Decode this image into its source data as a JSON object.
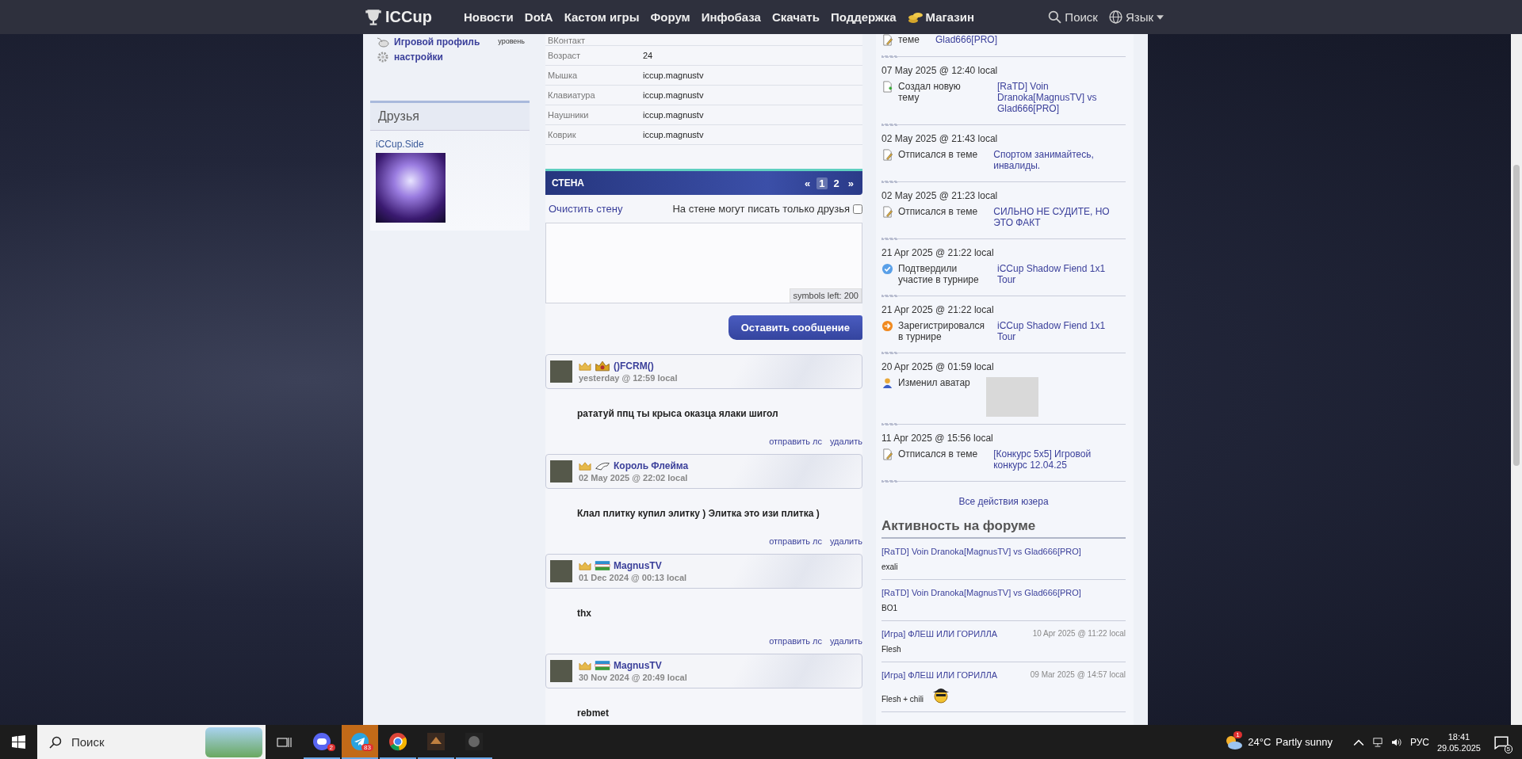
{
  "nav": {
    "logo": "ICCup",
    "items": [
      {
        "label": "Новости",
        "kind": "plain"
      },
      {
        "label": "DotA",
        "kind": "plain"
      },
      {
        "label": "Кастом игры",
        "kind": "plain"
      },
      {
        "label": "Форум",
        "kind": "plain"
      },
      {
        "label": "Инфобаза",
        "kind": "plain"
      },
      {
        "label": "Скачать",
        "kind": "plain"
      },
      {
        "label": "Поддержка",
        "kind": "plain"
      },
      {
        "label": "Магазин",
        "kind": "shop"
      }
    ],
    "search": "Поиск",
    "language": "Язык"
  },
  "left": {
    "links": [
      {
        "label": "Игровой профиль",
        "kind": "mouse"
      },
      {
        "label": "настройки",
        "kind": "gear"
      }
    ],
    "level_label": "уровень",
    "friends": {
      "title": "Друзья",
      "items": [
        {
          "name": "iCCup.Side"
        }
      ]
    }
  },
  "profile": {
    "rows": [
      {
        "label": "ВКонтакт"
      },
      {
        "label": "Возраст",
        "value": "24"
      },
      {
        "label": "Мышка",
        "value": "iccup.magnustv"
      },
      {
        "label": "Клавиатура",
        "value": "iccup.magnustv"
      },
      {
        "label": "Наушники",
        "value": "iccup.magnustv"
      },
      {
        "label": "Коврик",
        "value": "iccup.magnustv"
      }
    ]
  },
  "wall": {
    "title": "СТЕНА",
    "prev": "«",
    "next": "»",
    "pages": [
      {
        "label": "1",
        "selected": true
      },
      {
        "label": "2",
        "selected": false
      }
    ],
    "clear": "Очистить стену",
    "friends_only": {
      "label": "На стене могут писать только друзья",
      "checked": false
    },
    "counter": "symbols left: 200",
    "submit": "Оставить сообщение",
    "posts": [
      {
        "author": "()FCRM()",
        "kind": "emblem",
        "time": "yesterday @ 12:59 local",
        "text": "рататуй ппц ты крыса оказца ялаки шигол",
        "actions": [
          "отправить лс",
          "удалить"
        ]
      },
      {
        "author": "Король Флейма",
        "kind": "hat",
        "time": "02 May 2025 @ 22:02 local",
        "text": "Клал плитку купил элитку ) Элитка это изи плитка )",
        "actions": [
          "отправить лс",
          "удалить"
        ]
      },
      {
        "author": "MagnusTV",
        "kind": "flag",
        "time": "01 Dec 2024 @ 00:13 local",
        "text": "thx",
        "actions": [
          "отправить лс",
          "удалить"
        ]
      },
      {
        "author": "MagnusTV",
        "kind": "flag",
        "time": "30 Nov 2024 @ 20:49 local",
        "text": "rebmet"
      }
    ]
  },
  "activity": {
    "items": [
      {
        "kind": "reply",
        "action": "теме",
        "link": "Glad666[PRO]"
      },
      {
        "date": "07 May 2025 @ 12:40 local",
        "kind": "new_topic",
        "action": "Создал новую тему",
        "link": "[RaTD] Voin Dranoka[MagnusTV] vs Glad666[PRO]"
      },
      {
        "date": "02 May 2025 @ 21:43 local",
        "kind": "reply",
        "action": "Отписался в теме",
        "link": "Спортом занимайтесь, инвалиды."
      },
      {
        "date": "02 May 2025 @ 21:23 local",
        "kind": "reply",
        "action": "Отписался в теме",
        "link": "СИЛЬНО НЕ СУДИТЕ, НО ЭТО ФАКТ"
      },
      {
        "date": "21 Apr 2025 @ 21:22 local",
        "kind": "confirm",
        "action": "Подтвердили участие в турнире",
        "link": "iCCup Shadow Fiend 1x1 Tour"
      },
      {
        "date": "21 Apr 2025 @ 21:22 local",
        "kind": "register",
        "action": "Зарегистрировался в турнире",
        "link": "iCCup Shadow Fiend 1x1 Tour"
      },
      {
        "date": "20 Apr 2025 @ 01:59 local",
        "kind": "avatar",
        "action": "Изменил аватар"
      },
      {
        "date": "11 Apr 2025 @ 15:56 local",
        "kind": "reply",
        "action": "Отписался в теме",
        "link": "[Конкурс 5x5] Игровой конкурс 12.04.25"
      }
    ],
    "all_link": "Все действия юзера"
  },
  "forum": {
    "title": "Активность на форуме",
    "items": [
      {
        "title": "[RaTD] Voin Dranoka[MagnusTV] vs Glad666[PRO]",
        "snippet": "exali",
        "smiley": false
      },
      {
        "title": "[RaTD] Voin Dranoka[MagnusTV] vs Glad666[PRO]",
        "snippet": "BO1",
        "smiley": false
      },
      {
        "title": "[Игра] ФЛЕШ ИЛИ ГОРИЛЛА",
        "date": "10 Apr 2025 @ 11:22 local",
        "snippet": "Flesh",
        "smiley": false
      },
      {
        "title": "[Игра] ФЛЕШ ИЛИ ГОРИЛЛА",
        "date": "09 Mar 2025 @ 14:57 local",
        "snippet": "Flesh + chili",
        "smiley": true
      }
    ]
  },
  "taskbar": {
    "search": "Поиск",
    "apps": [
      {
        "kind": "chat",
        "badge": "2",
        "attention": false
      },
      {
        "kind": "telegram",
        "badge": "83",
        "attention": true
      },
      {
        "kind": "browser",
        "attention": false
      },
      {
        "kind": "game",
        "attention": false
      },
      {
        "kind": "game2",
        "attention": false
      }
    ],
    "weather_badge": "1",
    "temperature": "24°C",
    "weather": "Partly sunny",
    "lang": "РУС",
    "time": "18:41",
    "date": "29.05.2025",
    "notifications": "5"
  }
}
